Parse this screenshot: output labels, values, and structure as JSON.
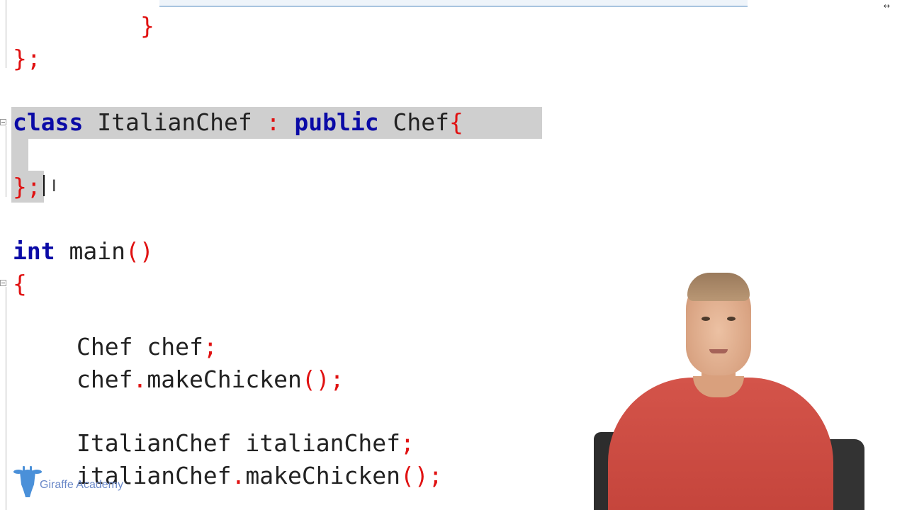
{
  "editor": {
    "lines": [
      {
        "id": "close-brace-inner",
        "tokens": [
          {
            "t": "}",
            "c": "pu"
          }
        ]
      },
      {
        "id": "close-class-chef",
        "tokens": [
          {
            "t": "};",
            "c": "pu"
          }
        ]
      },
      {
        "id": "class-decl",
        "tokens": [
          {
            "t": "class",
            "c": "kw"
          },
          {
            "t": " ItalianChef ",
            "c": "id"
          },
          {
            "t": ":",
            "c": "pu"
          },
          {
            "t": " ",
            "c": "id"
          },
          {
            "t": "public",
            "c": "kw"
          },
          {
            "t": " Chef",
            "c": "id"
          },
          {
            "t": "{",
            "c": "pu"
          }
        ]
      },
      {
        "id": "class-close",
        "tokens": [
          {
            "t": "};",
            "c": "pu"
          }
        ]
      },
      {
        "id": "main-decl",
        "tokens": [
          {
            "t": "int",
            "c": "kw"
          },
          {
            "t": " main",
            "c": "id"
          },
          {
            "t": "()",
            "c": "pu"
          }
        ]
      },
      {
        "id": "main-open",
        "tokens": [
          {
            "t": "{",
            "c": "pu"
          }
        ]
      },
      {
        "id": "chef-decl",
        "tokens": [
          {
            "t": "Chef chef",
            "c": "id"
          },
          {
            "t": ";",
            "c": "pu"
          }
        ]
      },
      {
        "id": "chef-call",
        "tokens": [
          {
            "t": "chef",
            "c": "id"
          },
          {
            "t": ".",
            "c": "pu"
          },
          {
            "t": "makeChicken",
            "c": "id"
          },
          {
            "t": "();",
            "c": "pu"
          }
        ]
      },
      {
        "id": "italian-decl",
        "tokens": [
          {
            "t": "ItalianChef italianChef",
            "c": "id"
          },
          {
            "t": ";",
            "c": "pu"
          }
        ]
      },
      {
        "id": "italian-call",
        "tokens": [
          {
            "t": "italianChef",
            "c": "id"
          },
          {
            "t": ".",
            "c": "pu"
          },
          {
            "t": "makeChicken",
            "c": "id"
          },
          {
            "t": "();",
            "c": "pu"
          }
        ]
      }
    ]
  },
  "watermark": {
    "brand": "Giraffe Academy",
    "icon": "giraffe-icon",
    "color": "#4a90d9"
  },
  "colors": {
    "keyword": "#0a0aa6",
    "punctuation": "#e01212",
    "selection": "#cfcfcf"
  },
  "icons": {
    "fold_marker": "fold-minus-icon",
    "text_cursor": "ibeam-cursor-icon",
    "resize_handle": "resize-handle-icon"
  }
}
